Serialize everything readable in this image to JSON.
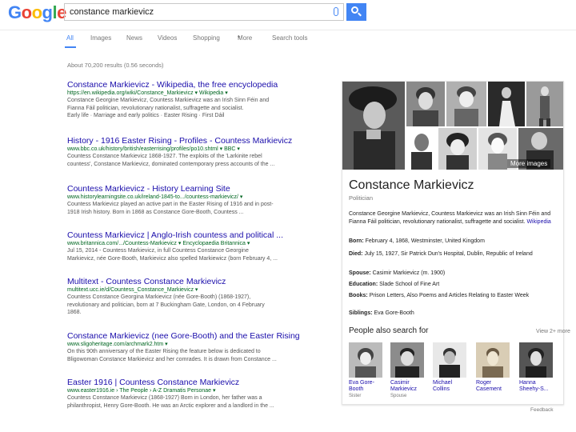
{
  "header": {
    "logo_letters": [
      "G",
      "o",
      "o",
      "g",
      "l",
      "e"
    ],
    "search_query": "constance markievicz"
  },
  "nav": {
    "tabs": [
      {
        "label": "All",
        "active": true
      },
      {
        "label": "Images"
      },
      {
        "label": "News"
      },
      {
        "label": "Videos"
      },
      {
        "label": "Shopping"
      },
      {
        "label": "More"
      },
      {
        "label": "Search tools"
      }
    ],
    "more_caret": "▾"
  },
  "stats": "About 70,200 results (0.56 seconds)",
  "results": [
    {
      "title": "Constance Markievicz - Wikipedia, the free encyclopedia",
      "url": "https://en.wikipedia.org/wiki/Constance_Markievicz ▾  Wikipedia ▾",
      "snippet": [
        "Constance Georgine Markievicz, Countess Markievicz was an Irish Sinn Féin and",
        "Fianna Fáil politician, revolutionary nationalist, suffragette and socialist.",
        "Early life · Marriage and early politics · Easter Rising · First Dáil"
      ]
    },
    {
      "title": "History - 1916 Easter Rising - Profiles - Countess Markievicz",
      "url": "www.bbc.co.uk/history/british/easterrising/profiles/po10.shtml ▾  BBC ▾",
      "snippet": [
        "Countess Constance Markievicz 1868-1927. The exploits of the 'Larkinite rebel",
        "countess', Constance Markievicz, dominated contemporary press accounts of the ..."
      ]
    },
    {
      "title": "Countess Markievicz - History Learning Site",
      "url": "www.historylearningsite.co.uk/ireland-1845-to.../countess-markievicz/ ▾",
      "snippet": [
        "Countess Markievicz played an active part in the Easter Rising of 1916 and in post-",
        "1918 Irish history. Born in 1868 as Constance Gore-Booth, Countess ..."
      ]
    },
    {
      "title": "Countess Markievicz | Anglo-Irish countess and political ...",
      "url": "www.britannica.com/.../Countess-Markievicz ▾  Encyclopaedia Britannica ▾",
      "snippet": [
        "Jul 15, 2014 - Countess Markievicz, in full Countess Constance Georgine",
        "Markievicz, née Gore-Booth, Markievicz also spelled Markiewicz (born February 4, ..."
      ]
    },
    {
      "title": "Multitext - Countess Constance Markievicz",
      "url": "multitext.ucc.ie/d/Countess_Constance_Markievicz ▾",
      "snippet": [
        "Countess Constance Georgina Markievicz (née Gore-Booth) (1868-1927),",
        "revolutionary and politician, born at 7 Buckingham Gate, London, on 4 February",
        "1868."
      ]
    },
    {
      "title": "Constance Markievicz (nee Gore-Booth) and the Easter Rising",
      "url": "www.sligoheritage.com/archmark2.htm ▾",
      "snippet": [
        "On this 90th anniversary of the Easter Rising the feature below is dedicated to",
        "Bligowoman Constance Markievicz and her comrades. It is drawn from Constance ..."
      ]
    },
    {
      "title": "Easter 1916 | Countess Constance Markievicz",
      "url": "www.easter1916.ie › The People › A-Z Dramatis Personae ▾",
      "snippet": [
        "Countess Constance Markievicz (1868-1927) Born in London, her father was a",
        "philanthropist, Henry Gore-Booth. He was an Arctic explorer and a landlord in the ..."
      ]
    }
  ],
  "panel": {
    "more_images": "More images",
    "title": "Constance Markievicz",
    "subtitle": "Politician",
    "description": "Constance Georgine Markievicz, Countess Markievicz was an Irish Sinn Féin and Fianna Fáil politician, revolutionary nationalist, suffragette and socialist.",
    "description_link": "Wikipedia",
    "facts": [
      {
        "label": "Born:",
        "value": "February 4, 1868, Westminster, United Kingdom"
      },
      {
        "label": "Died:",
        "value": "July 15, 1927, Sir Patrick Dun's Hospital, Dublin, Republic of Ireland"
      },
      {
        "label": "Spouse:",
        "value": "Casimir Markievicz (m. 1900)"
      },
      {
        "label": "Education:",
        "value": "Slade School of Fine Art"
      },
      {
        "label": "Books:",
        "value": "Prison Letters, Also Poems and Articles Relating to Easter Week"
      },
      {
        "label": "Siblings:",
        "value": "Eva Gore-Booth"
      }
    ],
    "people_title": "People also search for",
    "people_more": "View 2+ more",
    "people": [
      {
        "name": "Eva Gore-Booth",
        "role": "Sister"
      },
      {
        "name": "Casimir Markievicz",
        "role": "Spouse"
      },
      {
        "name": "Michael Collins",
        "role": ""
      },
      {
        "name": "Roger Casement",
        "role": ""
      },
      {
        "name": "Hanna Sheehy-S...",
        "role": ""
      }
    ],
    "feedback": "Feedback"
  },
  "colors": {
    "link": "#1a0dab",
    "url": "#006621",
    "accent": "#4285f4",
    "logo": [
      "#4285f4",
      "#ea4335",
      "#fbbc05",
      "#4285f4",
      "#34a853",
      "#ea4335"
    ]
  }
}
